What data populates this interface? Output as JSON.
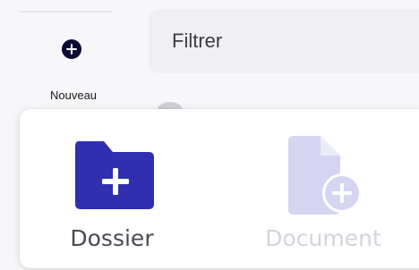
{
  "toolbar": {
    "new_label": "Nouveau"
  },
  "filter": {
    "placeholder": "Filtrer",
    "value": ""
  },
  "new_menu": {
    "items": [
      {
        "label": "Dossier",
        "icon": "folder-plus-icon",
        "enabled": true,
        "color": "#2f2fb0"
      },
      {
        "label": "Document",
        "icon": "document-plus-icon",
        "enabled": false,
        "color": "#d5d5f2"
      }
    ]
  },
  "colors": {
    "accent": "#2f2fb0",
    "accent_disabled": "#d5d5f2",
    "new_button": "#0a0a33"
  }
}
